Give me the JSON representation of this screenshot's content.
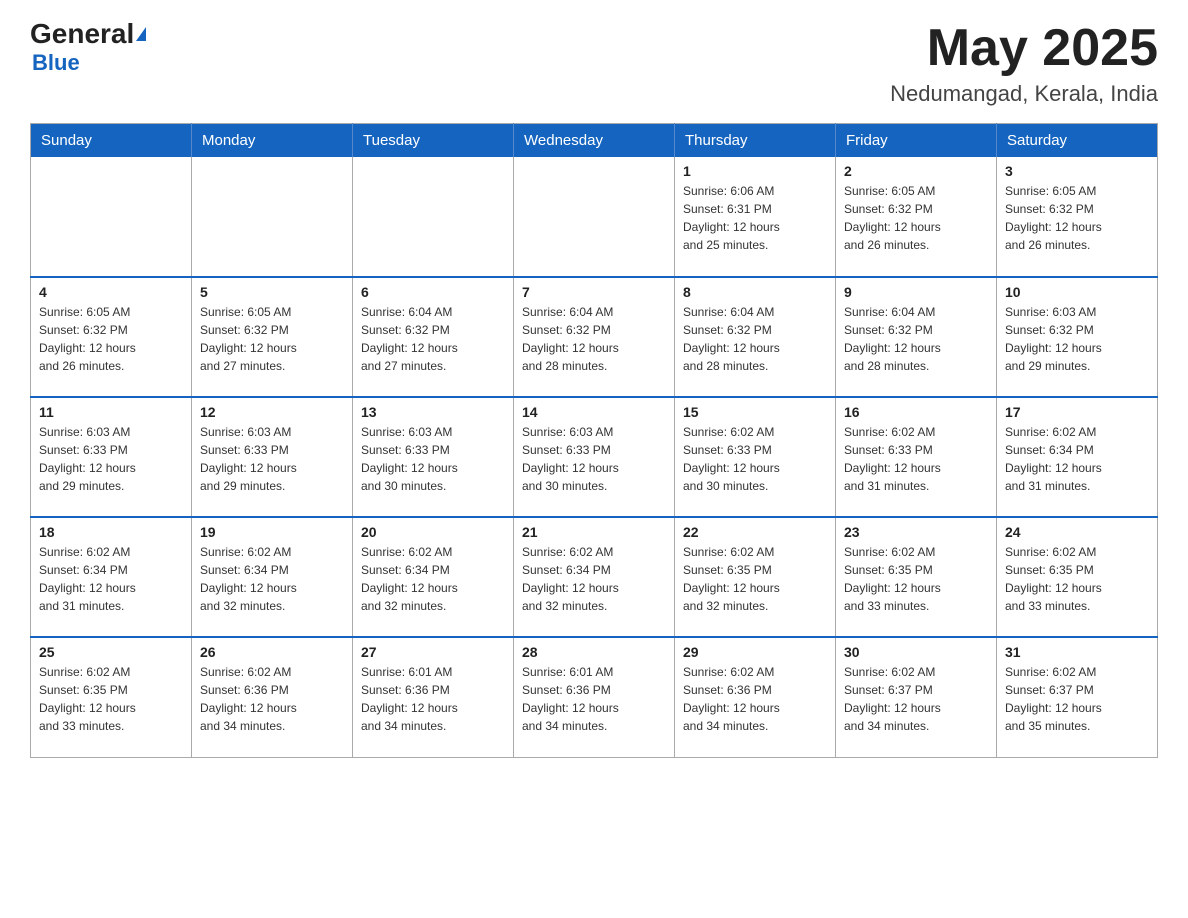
{
  "header": {
    "logo_main": "General",
    "logo_sub": "Blue",
    "month_title": "May 2025",
    "location": "Nedumangad, Kerala, India"
  },
  "weekdays": [
    "Sunday",
    "Monday",
    "Tuesday",
    "Wednesday",
    "Thursday",
    "Friday",
    "Saturday"
  ],
  "weeks": [
    [
      {
        "day": "",
        "info": ""
      },
      {
        "day": "",
        "info": ""
      },
      {
        "day": "",
        "info": ""
      },
      {
        "day": "",
        "info": ""
      },
      {
        "day": "1",
        "info": "Sunrise: 6:06 AM\nSunset: 6:31 PM\nDaylight: 12 hours\nand 25 minutes."
      },
      {
        "day": "2",
        "info": "Sunrise: 6:05 AM\nSunset: 6:32 PM\nDaylight: 12 hours\nand 26 minutes."
      },
      {
        "day": "3",
        "info": "Sunrise: 6:05 AM\nSunset: 6:32 PM\nDaylight: 12 hours\nand 26 minutes."
      }
    ],
    [
      {
        "day": "4",
        "info": "Sunrise: 6:05 AM\nSunset: 6:32 PM\nDaylight: 12 hours\nand 26 minutes."
      },
      {
        "day": "5",
        "info": "Sunrise: 6:05 AM\nSunset: 6:32 PM\nDaylight: 12 hours\nand 27 minutes."
      },
      {
        "day": "6",
        "info": "Sunrise: 6:04 AM\nSunset: 6:32 PM\nDaylight: 12 hours\nand 27 minutes."
      },
      {
        "day": "7",
        "info": "Sunrise: 6:04 AM\nSunset: 6:32 PM\nDaylight: 12 hours\nand 28 minutes."
      },
      {
        "day": "8",
        "info": "Sunrise: 6:04 AM\nSunset: 6:32 PM\nDaylight: 12 hours\nand 28 minutes."
      },
      {
        "day": "9",
        "info": "Sunrise: 6:04 AM\nSunset: 6:32 PM\nDaylight: 12 hours\nand 28 minutes."
      },
      {
        "day": "10",
        "info": "Sunrise: 6:03 AM\nSunset: 6:32 PM\nDaylight: 12 hours\nand 29 minutes."
      }
    ],
    [
      {
        "day": "11",
        "info": "Sunrise: 6:03 AM\nSunset: 6:33 PM\nDaylight: 12 hours\nand 29 minutes."
      },
      {
        "day": "12",
        "info": "Sunrise: 6:03 AM\nSunset: 6:33 PM\nDaylight: 12 hours\nand 29 minutes."
      },
      {
        "day": "13",
        "info": "Sunrise: 6:03 AM\nSunset: 6:33 PM\nDaylight: 12 hours\nand 30 minutes."
      },
      {
        "day": "14",
        "info": "Sunrise: 6:03 AM\nSunset: 6:33 PM\nDaylight: 12 hours\nand 30 minutes."
      },
      {
        "day": "15",
        "info": "Sunrise: 6:02 AM\nSunset: 6:33 PM\nDaylight: 12 hours\nand 30 minutes."
      },
      {
        "day": "16",
        "info": "Sunrise: 6:02 AM\nSunset: 6:33 PM\nDaylight: 12 hours\nand 31 minutes."
      },
      {
        "day": "17",
        "info": "Sunrise: 6:02 AM\nSunset: 6:34 PM\nDaylight: 12 hours\nand 31 minutes."
      }
    ],
    [
      {
        "day": "18",
        "info": "Sunrise: 6:02 AM\nSunset: 6:34 PM\nDaylight: 12 hours\nand 31 minutes."
      },
      {
        "day": "19",
        "info": "Sunrise: 6:02 AM\nSunset: 6:34 PM\nDaylight: 12 hours\nand 32 minutes."
      },
      {
        "day": "20",
        "info": "Sunrise: 6:02 AM\nSunset: 6:34 PM\nDaylight: 12 hours\nand 32 minutes."
      },
      {
        "day": "21",
        "info": "Sunrise: 6:02 AM\nSunset: 6:34 PM\nDaylight: 12 hours\nand 32 minutes."
      },
      {
        "day": "22",
        "info": "Sunrise: 6:02 AM\nSunset: 6:35 PM\nDaylight: 12 hours\nand 32 minutes."
      },
      {
        "day": "23",
        "info": "Sunrise: 6:02 AM\nSunset: 6:35 PM\nDaylight: 12 hours\nand 33 minutes."
      },
      {
        "day": "24",
        "info": "Sunrise: 6:02 AM\nSunset: 6:35 PM\nDaylight: 12 hours\nand 33 minutes."
      }
    ],
    [
      {
        "day": "25",
        "info": "Sunrise: 6:02 AM\nSunset: 6:35 PM\nDaylight: 12 hours\nand 33 minutes."
      },
      {
        "day": "26",
        "info": "Sunrise: 6:02 AM\nSunset: 6:36 PM\nDaylight: 12 hours\nand 34 minutes."
      },
      {
        "day": "27",
        "info": "Sunrise: 6:01 AM\nSunset: 6:36 PM\nDaylight: 12 hours\nand 34 minutes."
      },
      {
        "day": "28",
        "info": "Sunrise: 6:01 AM\nSunset: 6:36 PM\nDaylight: 12 hours\nand 34 minutes."
      },
      {
        "day": "29",
        "info": "Sunrise: 6:02 AM\nSunset: 6:36 PM\nDaylight: 12 hours\nand 34 minutes."
      },
      {
        "day": "30",
        "info": "Sunrise: 6:02 AM\nSunset: 6:37 PM\nDaylight: 12 hours\nand 34 minutes."
      },
      {
        "day": "31",
        "info": "Sunrise: 6:02 AM\nSunset: 6:37 PM\nDaylight: 12 hours\nand 35 minutes."
      }
    ]
  ]
}
